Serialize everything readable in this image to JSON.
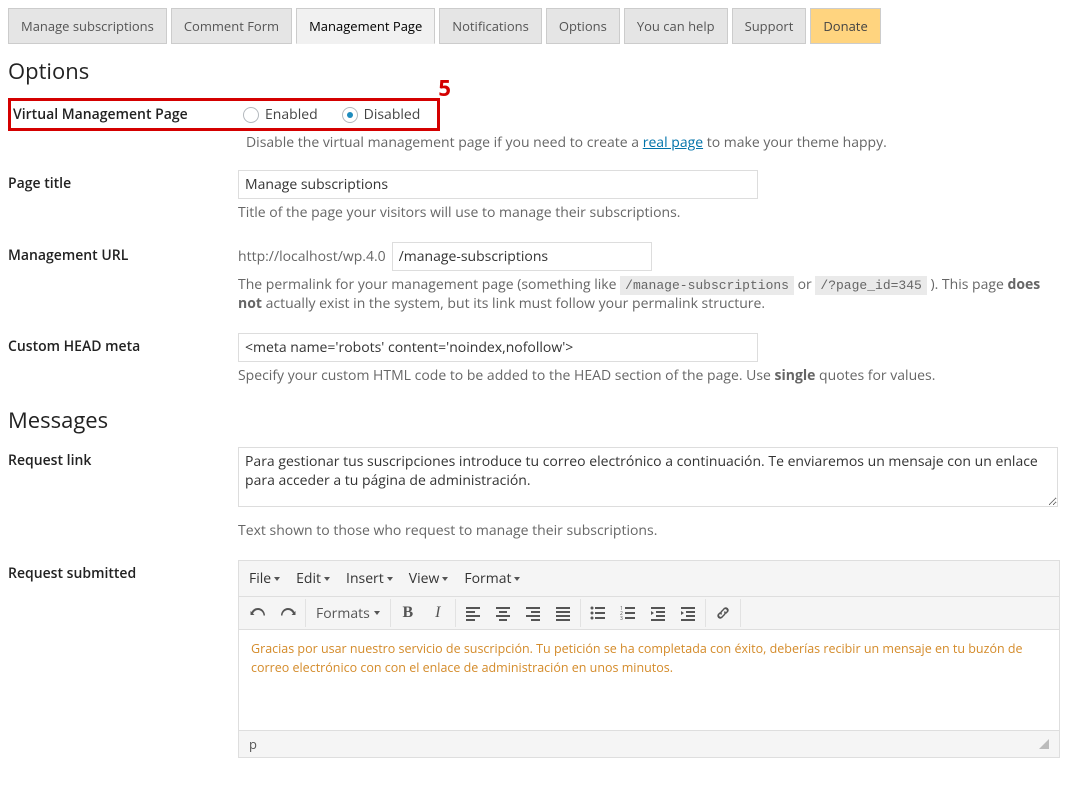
{
  "tabs": {
    "items": [
      "Manage subscriptions",
      "Comment Form",
      "Management Page",
      "Notifications",
      "Options",
      "You can help",
      "Support",
      "Donate"
    ]
  },
  "annotation": {
    "number": "5"
  },
  "sections": {
    "options_h": "Options",
    "messages_h": "Messages"
  },
  "vmp": {
    "label": "Virtual Management Page",
    "enabled": "Enabled",
    "disabled": "Disabled",
    "desc_a": "Disable the virtual management page if you need to create a ",
    "desc_link": "real page",
    "desc_b": " to make your theme happy."
  },
  "page_title": {
    "label": "Page title",
    "value": "Manage subscriptions",
    "desc": "Title of the page your visitors will use to manage their subscriptions."
  },
  "url": {
    "label": "Management URL",
    "prefix": "http://localhost/wp.4.0",
    "value": "/manage-subscriptions",
    "desc_a": "The permalink for your management page (something like ",
    "code1": "/manage-subscriptions",
    "desc_or": " or ",
    "code2": "/?page_id=345",
    "desc_b": " ). This page ",
    "desc_bold": "does not",
    "desc_c": " actually exist in the system, but its link must follow your permalink structure."
  },
  "head": {
    "label": "Custom HEAD meta",
    "value": "<meta name='robots' content='noindex,nofollow'>",
    "desc_a": "Specify your custom HTML code to be added to the HEAD section of the page. Use ",
    "desc_bold": "single",
    "desc_b": " quotes for values."
  },
  "reqlink": {
    "label": "Request link",
    "value": "Para gestionar tus suscripciones introduce tu correo electrónico a continuación. Te enviaremos un mensaje con un enlace para acceder a tu página de administración.",
    "desc": "Text shown to those who request to manage their subscriptions."
  },
  "reqsub": {
    "label": "Request submitted",
    "menus": {
      "file": "File",
      "edit": "Edit",
      "insert": "Insert",
      "view": "View",
      "format": "Format"
    },
    "formats_btn": "Formats",
    "body": "Gracias por usar nuestro servicio de suscripción. Tu petición se ha completada con éxito, deberías recibir un mensaje en tu buzón de correo electrónico con con el enlace de administración en unos minutos.",
    "path": "p"
  },
  "chart_data": null
}
